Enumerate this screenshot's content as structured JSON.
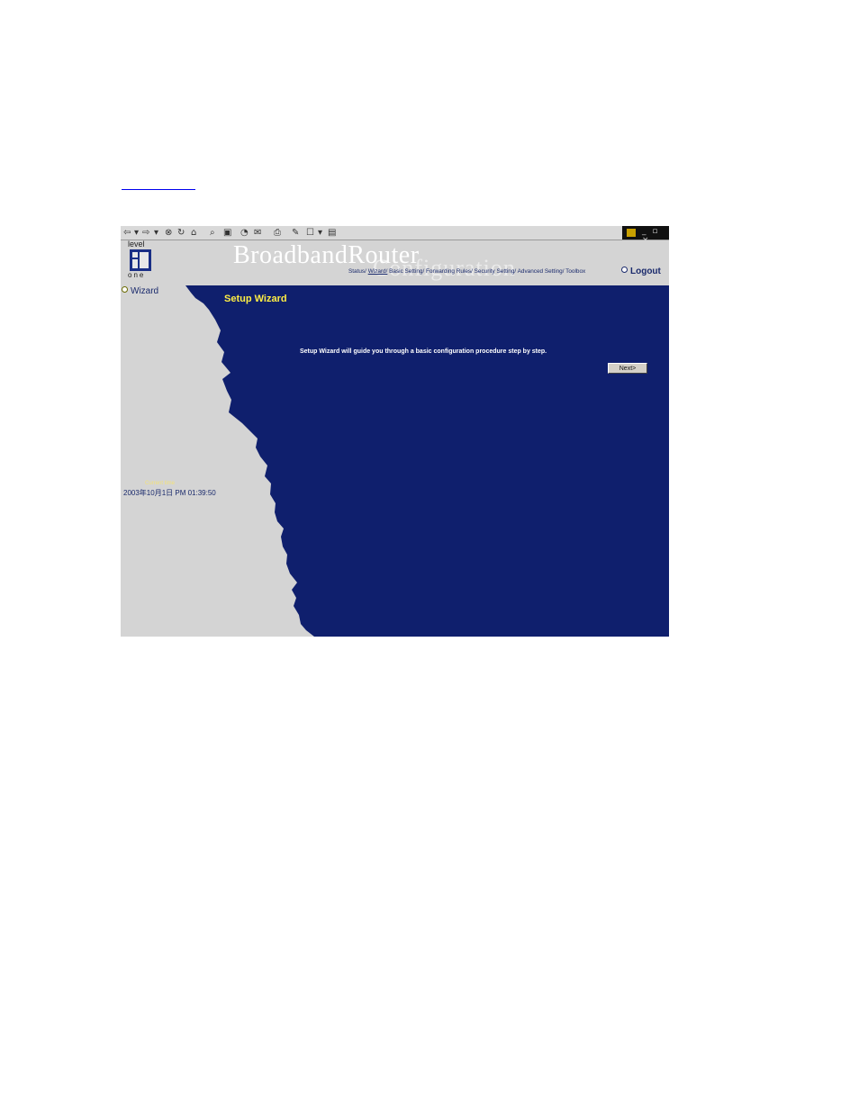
{
  "browser": {
    "toolbar_icons": [
      "back-icon",
      "forward-icon",
      "stop-icon",
      "refresh-icon",
      "home-icon",
      "search-icon",
      "favorites-icon",
      "history-icon",
      "mail-icon",
      "print-icon",
      "edit-icon"
    ]
  },
  "header": {
    "brand": "BroadbandRouter",
    "brand_sub": "Configuration",
    "logo_top": "level",
    "logo_bottom": "one"
  },
  "nav": {
    "items": [
      "Status/",
      "Wizard/",
      "Basic Setting/",
      "Forwarding Rules/",
      "Security Setting/",
      "Advanced Setting/",
      "Toolbox"
    ],
    "selected": "Wizard/",
    "logout": "Logout"
  },
  "sidebar": {
    "wizard": "Wizard",
    "time_label": "Current time",
    "time_value": "2003年10月1日 PM 01:39:50"
  },
  "main": {
    "title": "Setup Wizard",
    "message": "Setup Wizard will guide you through a basic configuration procedure step by step.",
    "next_button": "Next>"
  },
  "colors": {
    "main_bg": "#0f1f6d",
    "side_bg": "#d4d4d4",
    "title": "#ffee44"
  }
}
